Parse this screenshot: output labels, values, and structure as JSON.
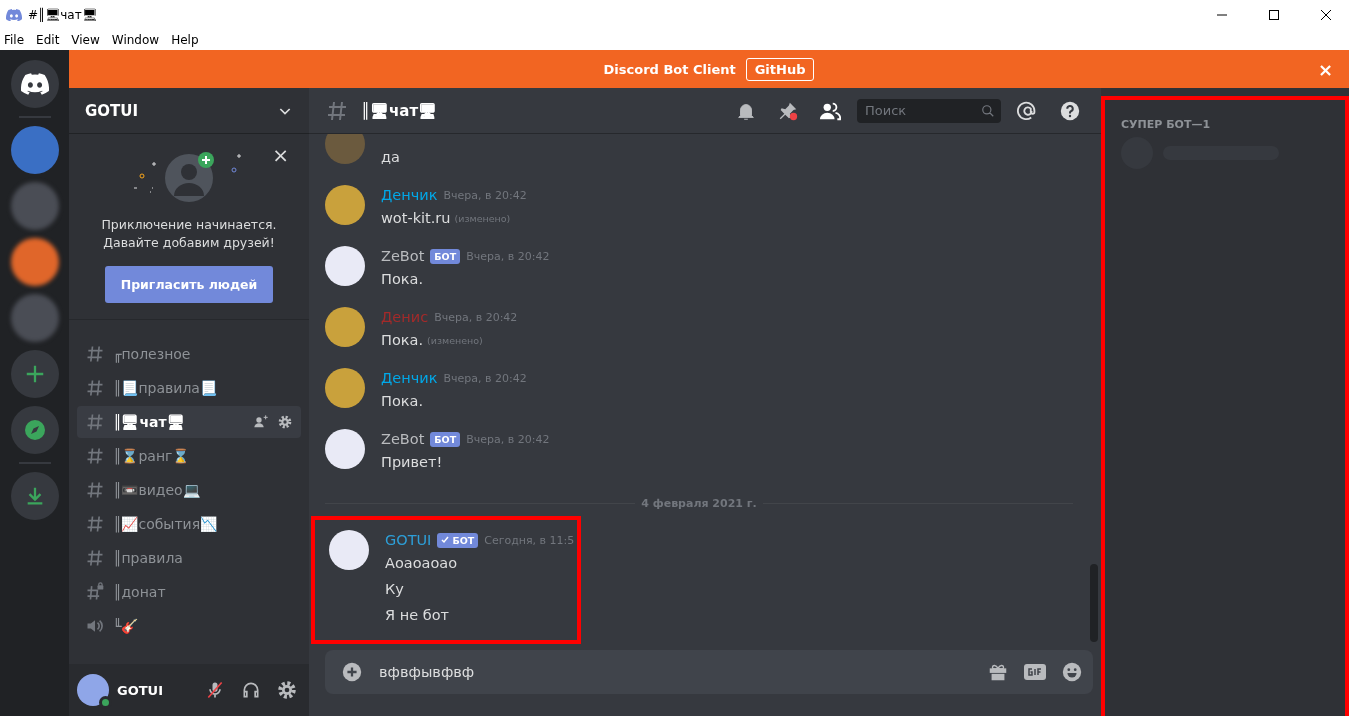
{
  "window": {
    "title": "#║🖥чат🖥",
    "menu": [
      "File",
      "Edit",
      "View",
      "Window",
      "Help"
    ]
  },
  "banner": {
    "title": "Discord Bot Client",
    "button": "GitHub",
    "close": "×"
  },
  "server": {
    "name": "GOTUI"
  },
  "invite_card": {
    "close": "×",
    "text": "Приключение начинается.\nДавайте добавим друзей!",
    "button": "Пригласить людей"
  },
  "channels": [
    {
      "kind": "text",
      "name": "╓полезное",
      "selected": false
    },
    {
      "kind": "text",
      "name": "║📃правила📃",
      "selected": false
    },
    {
      "kind": "text",
      "name": "║🖥чат🖥",
      "selected": true
    },
    {
      "kind": "text",
      "name": "║⌛ранг⌛",
      "selected": false
    },
    {
      "kind": "text",
      "name": "║📼видео💻",
      "selected": false
    },
    {
      "kind": "text",
      "name": "║📈события📉",
      "selected": false
    },
    {
      "kind": "text",
      "name": "║правила",
      "selected": false
    },
    {
      "kind": "locked",
      "name": "║донат",
      "selected": false
    },
    {
      "kind": "voice",
      "name": "╙🎸",
      "selected": false
    }
  ],
  "user_panel": {
    "name": "GOTUI",
    "muted": true
  },
  "chat_header": {
    "channel": "║🖥чат🖥",
    "search": {
      "placeholder": "Поиск"
    }
  },
  "messages": [
    {
      "kind": "continued",
      "lines": [
        "да"
      ]
    },
    {
      "kind": "message",
      "author": "Денчик",
      "color": "#00a8e8",
      "time": "Вчера, в 20:42",
      "lines": [
        "wot-kit.ru"
      ],
      "edited": "(изменено)"
    },
    {
      "kind": "message",
      "author": "ZeBot",
      "color": "#b9bbbe",
      "badge": "БОТ",
      "verified": false,
      "time": "Вчера, в 20:42",
      "lines": [
        "Пока."
      ]
    },
    {
      "kind": "message",
      "author": "Денис",
      "color": "#a32a2a",
      "time": "Вчера, в 20:42",
      "lines": [
        "Пока."
      ],
      "edited": "(изменено)"
    },
    {
      "kind": "message",
      "author": "Денчик",
      "color": "#00a8e8",
      "time": "Вчера, в 20:42",
      "lines": [
        "Пока."
      ]
    },
    {
      "kind": "message",
      "author": "ZeBot",
      "color": "#b9bbbe",
      "badge": "БОТ",
      "verified": false,
      "time": "Вчера, в 20:42",
      "lines": [
        "Привет!"
      ]
    },
    {
      "kind": "divider",
      "label": "4 февраля 2021 г."
    },
    {
      "kind": "message",
      "author": "GOTUI",
      "color": "#2d9fd8",
      "badge": "БОТ",
      "verified": true,
      "time": "Сегодня, в 11:5",
      "lines": [
        "Аоаоаоао",
        "Ку",
        "Я не бот"
      ],
      "highlighted": true
    }
  ],
  "composer": {
    "value": "вфвфывфвф"
  },
  "members": {
    "group": "СУПЕР БОТ—1",
    "highlighted": true
  }
}
